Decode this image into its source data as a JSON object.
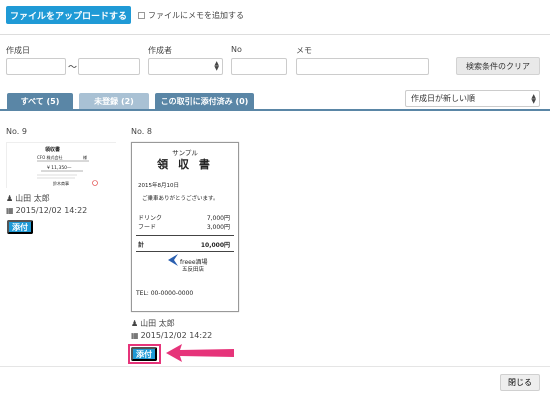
{
  "toolbar": {
    "upload_label": "ファイルをアップロードする",
    "memo_checkbox_label": "ファイルにメモを追加する"
  },
  "filter": {
    "created_date_label": "作成日",
    "range_separator": "〜",
    "creator_label": "作成者",
    "no_label": "No",
    "memo_label": "メモ",
    "clear_label": "検索条件のクリア"
  },
  "tabs": [
    {
      "label": "すべて (5)"
    },
    {
      "label": "未登録 (2)"
    },
    {
      "label": "この取引に添付済み (0)"
    }
  ],
  "sort": {
    "selected": "作成日が新しい順"
  },
  "cards": [
    {
      "no": "No. 9",
      "user": "山田 太郎",
      "datetime": "2015/12/02 14:22",
      "attach_label": "添付",
      "thumb": {
        "title": "領収書",
        "company": "CFO 株式会社",
        "honorific": "様",
        "amount": "¥ 11,350—",
        "footer": "鈴木商事"
      }
    },
    {
      "no": "No. 8",
      "user": "山田 太郎",
      "datetime": "2015/12/02 14:22",
      "attach_label": "添付",
      "receipt": {
        "sample": "サンプル",
        "title": "領 収 書",
        "date": "2015年8月10日",
        "thanks": "ご乗車ありがとうございます。",
        "items": [
          {
            "name": "ドリンク",
            "price": "7,000円"
          },
          {
            "name": "フード",
            "price": "3,000円"
          }
        ],
        "total_label": "計",
        "total": "10,000円",
        "store": "freee酒場",
        "branch": "五反田店",
        "tel": "TEL: 00-0000-0000"
      }
    }
  ],
  "footer": {
    "close_label": "閉じる"
  },
  "colors": {
    "primary": "#1f9ad6",
    "tab": "#5a86a6",
    "tab_inactive": "#a9c1d4",
    "highlight": "#e6347a"
  }
}
